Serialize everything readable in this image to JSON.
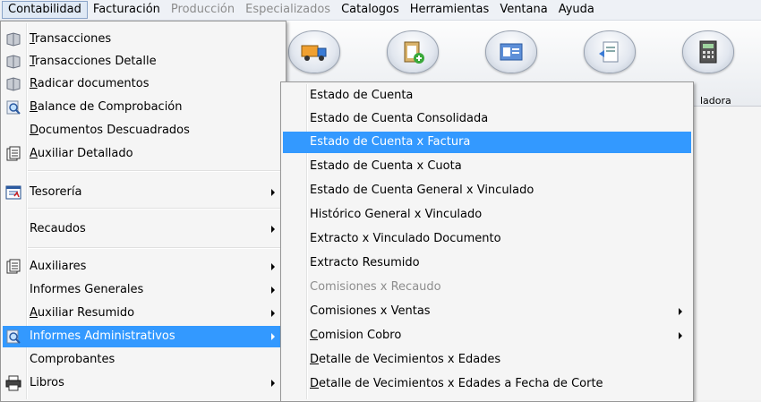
{
  "menubar": {
    "items": [
      "Contabilidad",
      "Facturación",
      "Producción",
      "Especializados",
      "Catalogos",
      "Herramientas",
      "Ventana",
      "Ayuda"
    ]
  },
  "toolbar": {
    "partial_label": "ladora"
  },
  "main_menu": {
    "items": [
      {
        "label": "Transacciones",
        "icon": "ledger-icon"
      },
      {
        "label": "Transacciones Detalle",
        "icon": "ledger-icon"
      },
      {
        "label": "Radicar documentos",
        "icon": "ledger-icon"
      },
      {
        "label": "Balance de Comprobación",
        "icon": "magnifier-icon"
      },
      {
        "label": "Documentos Descuadrados",
        "icon": ""
      },
      {
        "label": "Auxiliar Detallado",
        "icon": "report-icon"
      },
      {
        "label": "Tesorería",
        "icon": "treasury-icon"
      },
      {
        "label": "Recaudos",
        "icon": ""
      },
      {
        "label": "Auxiliares",
        "icon": "report-icon"
      },
      {
        "label": "Informes Generales",
        "icon": ""
      },
      {
        "label": "Auxiliar Resumido",
        "icon": ""
      },
      {
        "label": "Informes Administrativos",
        "icon": "magnifier-icon"
      },
      {
        "label": "Comprobantes",
        "icon": ""
      },
      {
        "label": "Libros",
        "icon": "printer-icon"
      }
    ]
  },
  "sub_menu": {
    "items": [
      {
        "label": "Estado de Cuenta"
      },
      {
        "label": "Estado de Cuenta Consolidada"
      },
      {
        "label": "Estado de Cuenta x Factura"
      },
      {
        "label": "Estado de Cuenta x Cuota"
      },
      {
        "label": "Estado de Cuenta General x Vinculado"
      },
      {
        "label": "Histórico General x Vinculado"
      },
      {
        "label": "Extracto x Vinculado Documento"
      },
      {
        "label": "Extracto Resumido"
      },
      {
        "label": "Comisiones x Recaudo"
      },
      {
        "label": "Comisiones x Ventas"
      },
      {
        "label": "Comision Cobro"
      },
      {
        "label": "Detalle de Vecimientos x Edades"
      },
      {
        "label": "Detalle de Vecimientos x Edades a Fecha de Corte"
      }
    ]
  },
  "colors": {
    "highlight": "#3399ff",
    "disabled": "#8d8d8d"
  }
}
